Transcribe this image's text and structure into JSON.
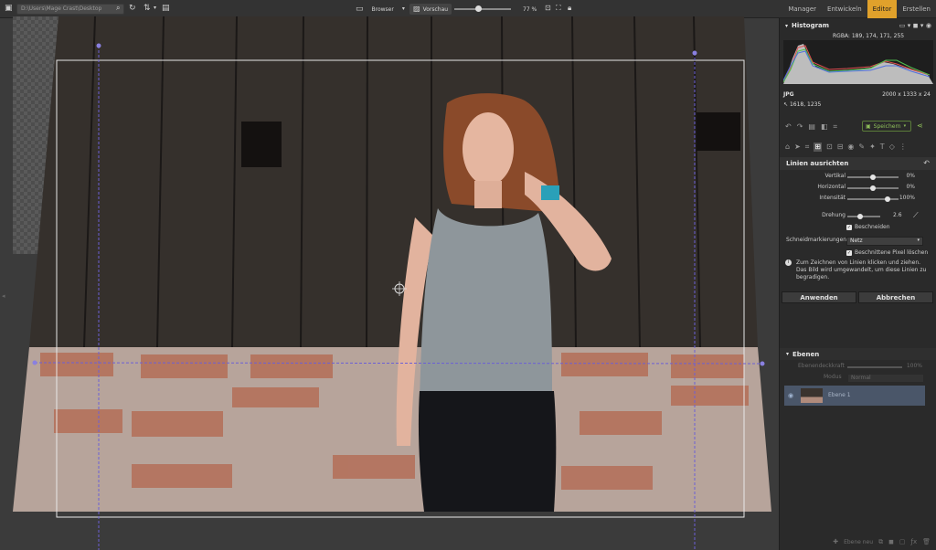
{
  "toolbar": {
    "path": "D:\\Users\\Mage Crast\\Desktop",
    "browser_label": "Browser",
    "preview_label": "Vorschau",
    "zoom": "77 %",
    "zoom_fraction": 0.42
  },
  "modes": {
    "manager": "Manager",
    "develop": "Entwickeln",
    "editor": "Editor",
    "create": "Erstellen"
  },
  "histogram": {
    "title": "Histogram",
    "rgba": "RGBA: 189, 174, 171, 255",
    "format": "JPG",
    "dimensions": "2000 x 1333 x 24",
    "cursor": "1618, 1235"
  },
  "save_label": "Speichern",
  "straighten": {
    "title": "Linien ausrichten",
    "vertical_label": "Vertikal",
    "vertical_value": "0%",
    "vertical_fraction": 0.5,
    "horizontal_label": "Horizontal",
    "horizontal_value": "0%",
    "horizontal_fraction": 0.5,
    "intensity_label": "Intensität",
    "intensity_value": "100%",
    "intensity_fraction": 0.78,
    "rotation_label": "Drehung",
    "rotation_value": "2.6",
    "rotation_fraction": 0.4,
    "crop_label": "Beschneiden",
    "crop_marks_label": "Schneidmarkierungen",
    "crop_marks_value": "Netz",
    "delete_pixels_label": "Beschnittene Pixel löschen",
    "info_text": "Zum Zeichnen von Linien klicken und ziehen. Das Bild wird umgewandelt, um diese Linien zu begradigen.",
    "apply_label": "Anwenden",
    "cancel_label": "Abbrechen"
  },
  "layers": {
    "title": "Ebenen",
    "opacity_label": "Ebenendeckkraft",
    "opacity_value": "100%",
    "mode_label": "Modus",
    "mode_value": "Normal",
    "layer_name": "Ebene 1",
    "add_layer_label": "Ebene neu"
  },
  "colors": {
    "accent": "#e0a12b",
    "panel": "#2a2a2a",
    "layer_selected": "#4a5669",
    "guide": "#6b5fd6"
  }
}
